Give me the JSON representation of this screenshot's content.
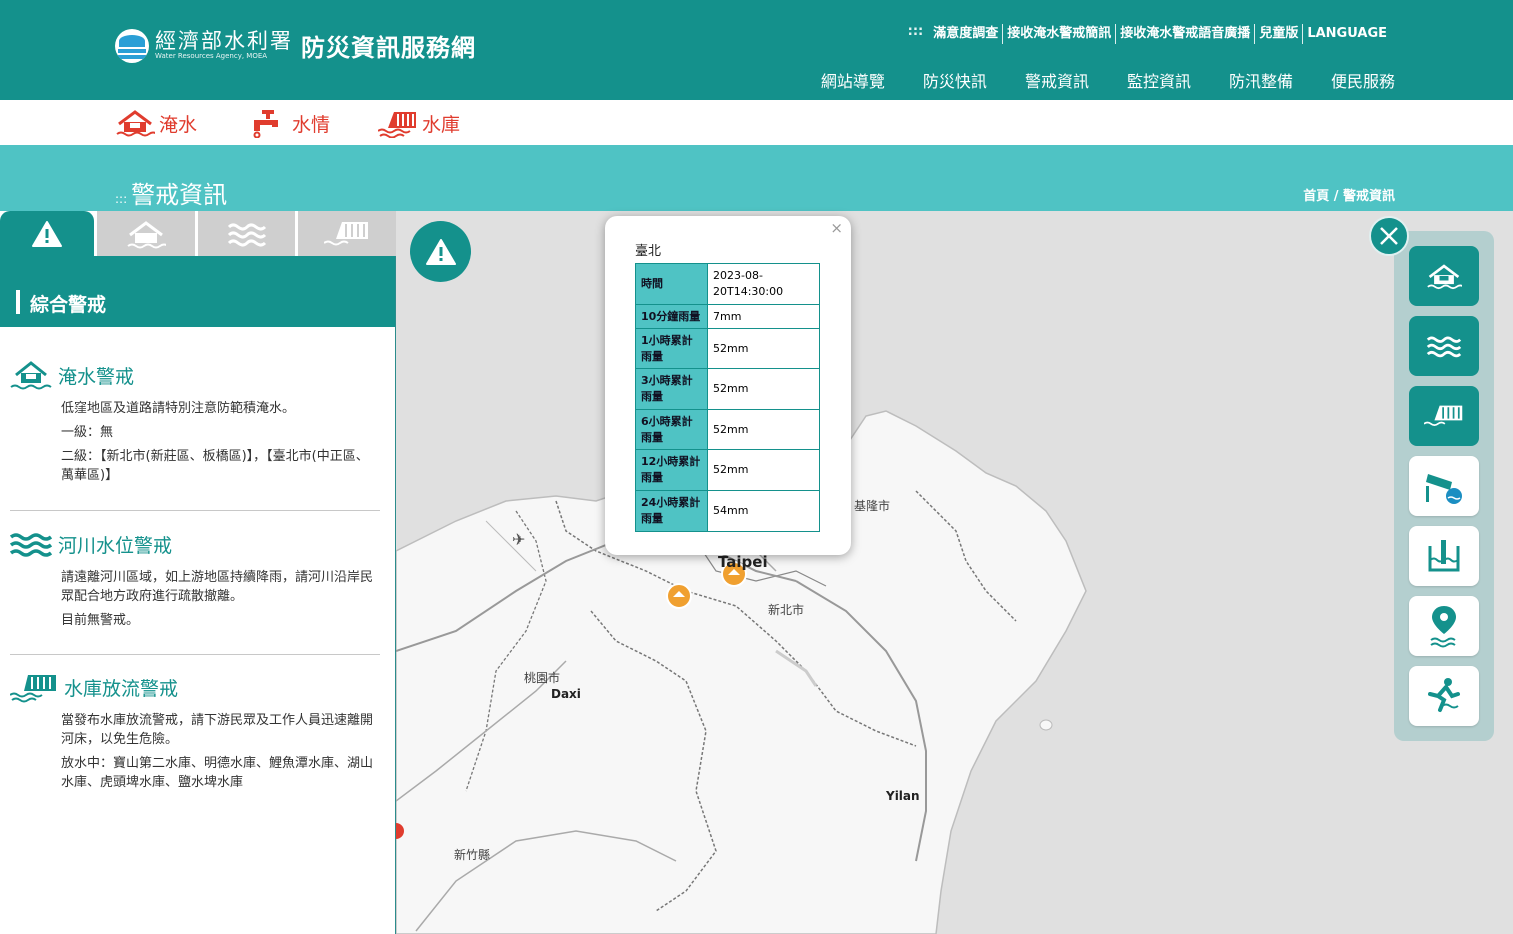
{
  "header": {
    "agency_name": "經濟部水利署",
    "agency_en": "Water Resources Agency, MOEA",
    "site_title": "防災資訊服務網",
    "top_links_deco": ":::",
    "top_links": [
      "滿意度調查",
      "接收淹水警戒簡訊",
      "接收淹水警戒語音廣播",
      "兒童版",
      "LANGUAGE"
    ],
    "nav": [
      "網站導覽",
      "防災快訊",
      "警戒資訊",
      "監控資訊",
      "防汛整備",
      "便民服務"
    ]
  },
  "quickbar": {
    "items": [
      {
        "label": "淹水",
        "icon": "flood-house-icon"
      },
      {
        "label": "水情",
        "icon": "faucet-icon"
      },
      {
        "label": "水庫",
        "icon": "dam-icon"
      }
    ]
  },
  "title_band": {
    "deco": ":::",
    "title": "警戒資訊",
    "breadcrumb": "首頁 / 警戒資訊"
  },
  "left_panel": {
    "section_title": "綜合警戒",
    "flood": {
      "title": "淹水警戒",
      "desc": "低窪地區及道路請特別注意防範積淹水。",
      "level1": "一級：無",
      "level2": "二級：【新北市(新莊區、板橋區)】，【臺北市(中正區、萬華區)】"
    },
    "river": {
      "title": "河川水位警戒",
      "desc": "請遠離河川區域，如上游地區持續降雨，請河川沿岸民眾配合地方政府進行疏散撤離。",
      "status": "目前無警戒。"
    },
    "reservoir": {
      "title": "水庫放流警戒",
      "desc": "當發布水庫放流警戒，請下游民眾及工作人員迅速離開河床，以免生危險。",
      "status": "放水中：寶山第二水庫、明德水庫、鯉魚潭水庫、湖山水庫、虎頭埤水庫、鹽水埤水庫"
    }
  },
  "popup": {
    "close": "×",
    "station": "臺北",
    "rows": [
      {
        "k": "時間",
        "v": "2023-08-20T14:30:00"
      },
      {
        "k": "10分鐘雨量",
        "v": "7mm"
      },
      {
        "k": "1小時累計雨量",
        "v": "52mm"
      },
      {
        "k": "3小時累計雨量",
        "v": "52mm"
      },
      {
        "k": "6小時累計雨量",
        "v": "52mm"
      },
      {
        "k": "12小時累計雨量",
        "v": "52mm"
      },
      {
        "k": "24小時累計雨量",
        "v": "54mm"
      }
    ]
  },
  "map_labels": {
    "keelung": "基隆市",
    "taipei": "Taipei",
    "new_taipei": "新北市",
    "taoyuan": "桃園市",
    "daxi": "Daxi",
    "yilan": "Yilan",
    "hsinchu": "新竹縣"
  },
  "colors": {
    "primary": "#14918c",
    "light_teal": "#4fc3c4",
    "quick_red": "#e03c2e",
    "marker_orange": "#f0a030"
  }
}
